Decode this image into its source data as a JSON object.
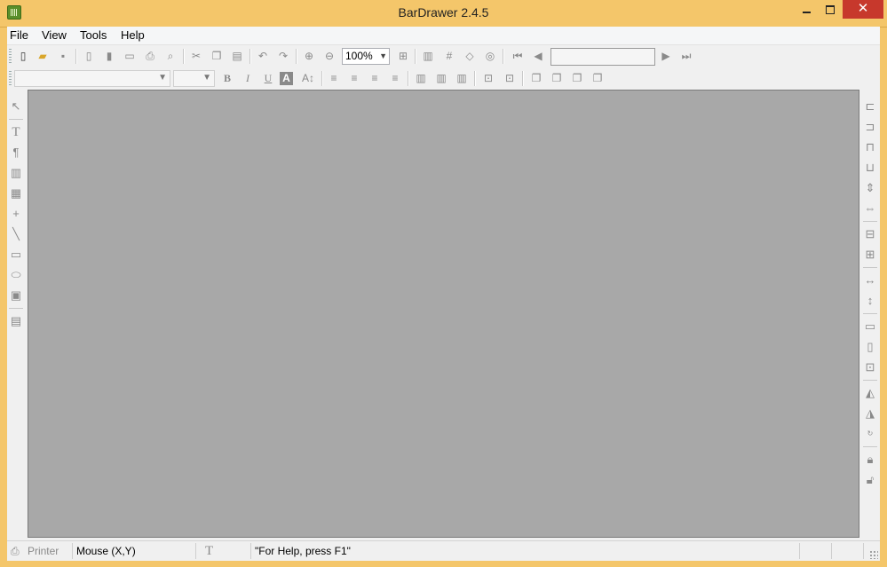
{
  "window": {
    "title": "BarDrawer 2.4.5",
    "minimize_glyph": "",
    "maximize_glyph": "",
    "close_glyph": "✕"
  },
  "menu": {
    "items": [
      {
        "label": "File"
      },
      {
        "label": "View"
      },
      {
        "label": "Tools"
      },
      {
        "label": "Help"
      }
    ]
  },
  "toolbar": {
    "zoom_value": "100%",
    "nav_field_value": "",
    "font_name_value": "",
    "font_size_value": "",
    "icons": [
      "new-file-icon",
      "open-folder-icon",
      "save-icon",
      "page-icon",
      "database-icon",
      "window-icon",
      "print-icon",
      "print-preview-icon",
      "cut-icon",
      "copy-icon",
      "paste-icon",
      "undo-icon",
      "redo-icon",
      "zoom-in-icon",
      "zoom-out-icon",
      "fit-page-icon",
      "barcode-settings-icon",
      "grid-icon",
      "tag-icon",
      "wizard-icon",
      "first-record-icon",
      "previous-record-icon",
      "next-record-icon",
      "last-record-icon"
    ]
  },
  "format_toolbar": {
    "bold": "B",
    "italic": "I",
    "underline": "U",
    "color": "A"
  },
  "status": {
    "printer": "Printer",
    "mouse": "Mouse (X,Y)",
    "help": "\"For Help, press F1\""
  },
  "colors": {
    "titlebar": "#f4c66a",
    "canvas": "#a8a8a8",
    "close_button": "#c7382c"
  }
}
